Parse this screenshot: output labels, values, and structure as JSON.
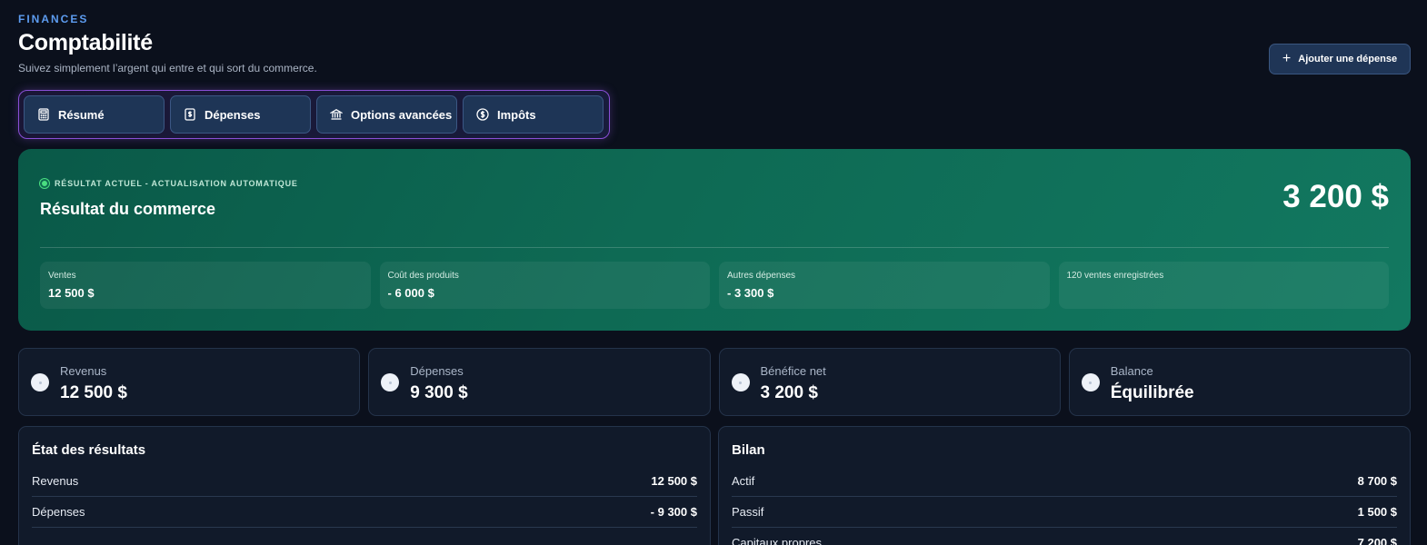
{
  "header": {
    "eyebrow": "FINANCES",
    "title": "Comptabilité",
    "subtitle": "Suivez simplement l’argent qui entre et qui sort du commerce.",
    "add_button": "Ajouter une dépense"
  },
  "tabs": [
    {
      "label": "Résumé",
      "icon": "calculator-icon"
    },
    {
      "label": "Dépenses",
      "icon": "receipt-dollar-icon"
    },
    {
      "label": "Options avancées",
      "icon": "bank-icon"
    },
    {
      "label": "Impôts",
      "icon": "dollar-circle-icon"
    }
  ],
  "hero": {
    "badge": "RÉSULTAT ACTUEL - ACTUALISATION AUTOMATIQUE",
    "title": "Résultat du commerce",
    "amount": "3 200 $",
    "stats": [
      {
        "label": "Ventes",
        "value": "12 500 $"
      },
      {
        "label": "Coût des produits",
        "value": "- 6 000 $"
      },
      {
        "label": "Autres dépenses",
        "value": "- 3 300 $"
      },
      {
        "label": "120 ventes enregistrées",
        "value": ""
      }
    ]
  },
  "kpis": [
    {
      "label": "Revenus",
      "value": "12 500 $"
    },
    {
      "label": "Dépenses",
      "value": "9 300 $"
    },
    {
      "label": "Bénéfice net",
      "value": "3 200 $"
    },
    {
      "label": "Balance",
      "value": "Équilibrée"
    }
  ],
  "income_statement": {
    "title": "État des résultats",
    "rows": [
      {
        "label": "Revenus",
        "value": "12 500 $"
      },
      {
        "label": "Dépenses",
        "value": "- 9 300 $"
      }
    ]
  },
  "balance_sheet": {
    "title": "Bilan",
    "rows": [
      {
        "label": "Actif",
        "value": "8 700 $"
      },
      {
        "label": "Passif",
        "value": "1 500 $"
      },
      {
        "label": "Capitaux propres",
        "value": "7 200 $"
      }
    ]
  },
  "colors": {
    "background": "#0b101c",
    "accent": "#5d9cf0",
    "hero_green": "#0e6a54",
    "tab_border": "#8a4fd6"
  }
}
